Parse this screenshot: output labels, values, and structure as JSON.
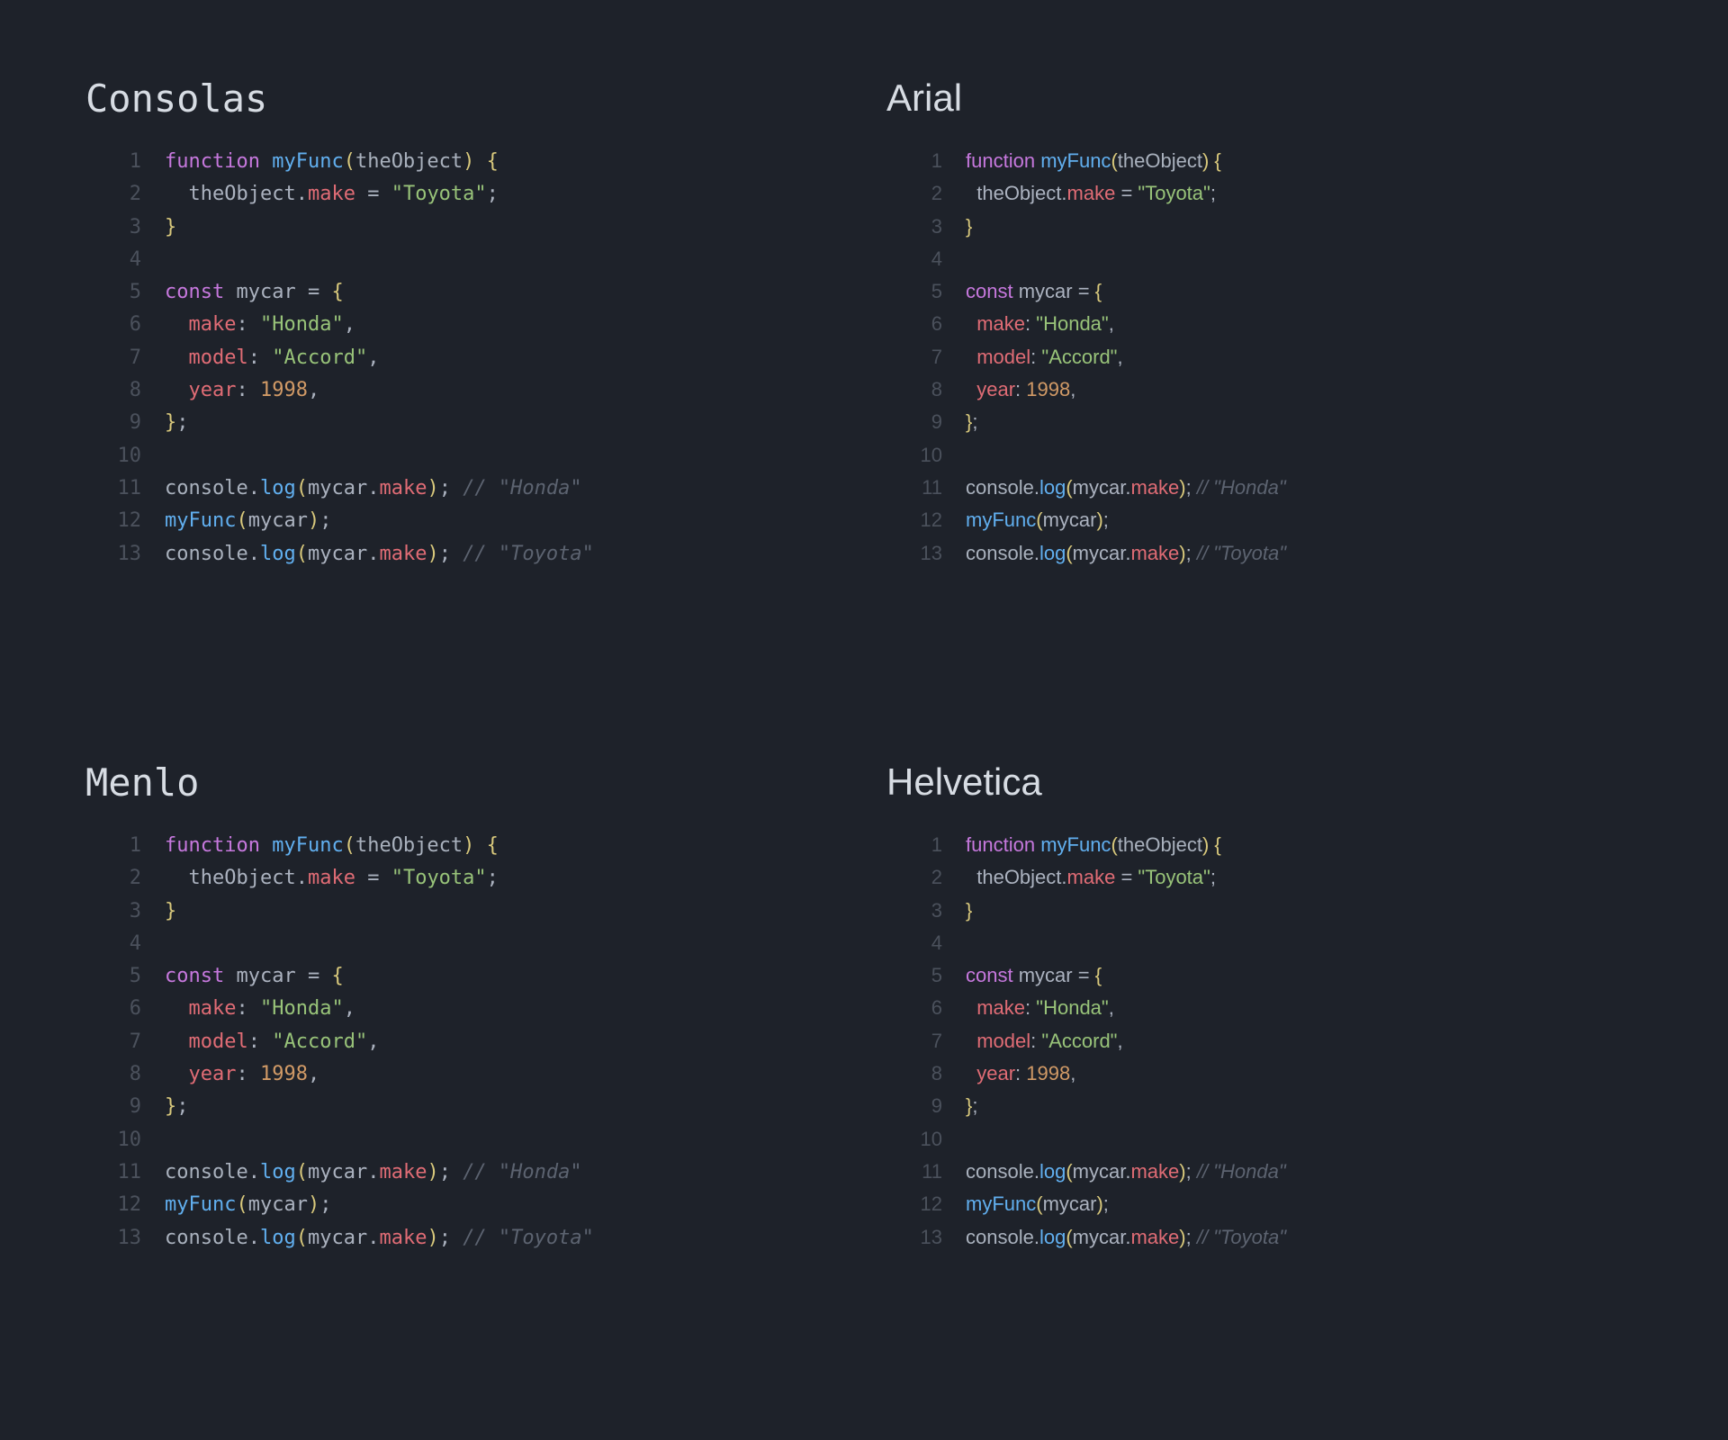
{
  "panels": [
    {
      "title": "Consolas",
      "fontClass": "f-consolas"
    },
    {
      "title": "Arial",
      "fontClass": "f-arial"
    },
    {
      "title": "Menlo",
      "fontClass": "f-menlo"
    },
    {
      "title": "Helvetica",
      "fontClass": "f-helvetica"
    }
  ],
  "lineNumbers": [
    "1",
    "2",
    "3",
    "4",
    "5",
    "6",
    "7",
    "8",
    "9",
    "10",
    "11",
    "12",
    "13"
  ],
  "code": [
    [
      {
        "t": "function",
        "c": "tok-kw"
      },
      {
        "t": " "
      },
      {
        "t": "myFunc",
        "c": "tok-fn"
      },
      {
        "t": "(",
        "c": "tok-brace"
      },
      {
        "t": "theObject",
        "c": "tok-param"
      },
      {
        "t": ")",
        "c": "tok-brace"
      },
      {
        "t": " "
      },
      {
        "t": "{",
        "c": "tok-brace"
      }
    ],
    [
      {
        "t": "  "
      },
      {
        "t": "theObject",
        "c": "tok-ident"
      },
      {
        "t": ".",
        "c": "tok-punct"
      },
      {
        "t": "make",
        "c": "tok-prop"
      },
      {
        "t": " = ",
        "c": "tok-punct"
      },
      {
        "t": "\"Toyota\"",
        "c": "tok-str"
      },
      {
        "t": ";",
        "c": "tok-punct"
      }
    ],
    [
      {
        "t": "}",
        "c": "tok-brace"
      }
    ],
    [
      {
        "t": ""
      }
    ],
    [
      {
        "t": "const",
        "c": "tok-kw"
      },
      {
        "t": " "
      },
      {
        "t": "mycar",
        "c": "tok-ident"
      },
      {
        "t": " = ",
        "c": "tok-punct"
      },
      {
        "t": "{",
        "c": "tok-brace"
      }
    ],
    [
      {
        "t": "  "
      },
      {
        "t": "make",
        "c": "tok-prop"
      },
      {
        "t": ":",
        "c": "tok-punct"
      },
      {
        "t": " "
      },
      {
        "t": "\"Honda\"",
        "c": "tok-str"
      },
      {
        "t": ",",
        "c": "tok-punct"
      }
    ],
    [
      {
        "t": "  "
      },
      {
        "t": "model",
        "c": "tok-prop"
      },
      {
        "t": ":",
        "c": "tok-punct"
      },
      {
        "t": " "
      },
      {
        "t": "\"Accord\"",
        "c": "tok-str"
      },
      {
        "t": ",",
        "c": "tok-punct"
      }
    ],
    [
      {
        "t": "  "
      },
      {
        "t": "year",
        "c": "tok-prop"
      },
      {
        "t": ":",
        "c": "tok-punct"
      },
      {
        "t": " "
      },
      {
        "t": "1998",
        "c": "tok-num"
      },
      {
        "t": ",",
        "c": "tok-punct"
      }
    ],
    [
      {
        "t": "}",
        "c": "tok-brace"
      },
      {
        "t": ";",
        "c": "tok-punct"
      }
    ],
    [
      {
        "t": ""
      }
    ],
    [
      {
        "t": "console",
        "c": "tok-obj"
      },
      {
        "t": ".",
        "c": "tok-punct"
      },
      {
        "t": "log",
        "c": "tok-call"
      },
      {
        "t": "(",
        "c": "tok-brace"
      },
      {
        "t": "mycar",
        "c": "tok-ident"
      },
      {
        "t": ".",
        "c": "tok-punct"
      },
      {
        "t": "make",
        "c": "tok-prop"
      },
      {
        "t": ")",
        "c": "tok-brace"
      },
      {
        "t": ";",
        "c": "tok-punct"
      },
      {
        "t": " "
      },
      {
        "t": "// \"Honda\"",
        "c": "tok-cmt"
      }
    ],
    [
      {
        "t": "myFunc",
        "c": "tok-fn"
      },
      {
        "t": "(",
        "c": "tok-brace"
      },
      {
        "t": "mycar",
        "c": "tok-ident"
      },
      {
        "t": ")",
        "c": "tok-brace"
      },
      {
        "t": ";",
        "c": "tok-punct"
      }
    ],
    [
      {
        "t": "console",
        "c": "tok-obj"
      },
      {
        "t": ".",
        "c": "tok-punct"
      },
      {
        "t": "log",
        "c": "tok-call"
      },
      {
        "t": "(",
        "c": "tok-brace"
      },
      {
        "t": "mycar",
        "c": "tok-ident"
      },
      {
        "t": ".",
        "c": "tok-punct"
      },
      {
        "t": "make",
        "c": "tok-prop"
      },
      {
        "t": ")",
        "c": "tok-brace"
      },
      {
        "t": ";",
        "c": "tok-punct"
      },
      {
        "t": " "
      },
      {
        "t": "// \"Toyota\"",
        "c": "tok-cmt"
      }
    ]
  ]
}
